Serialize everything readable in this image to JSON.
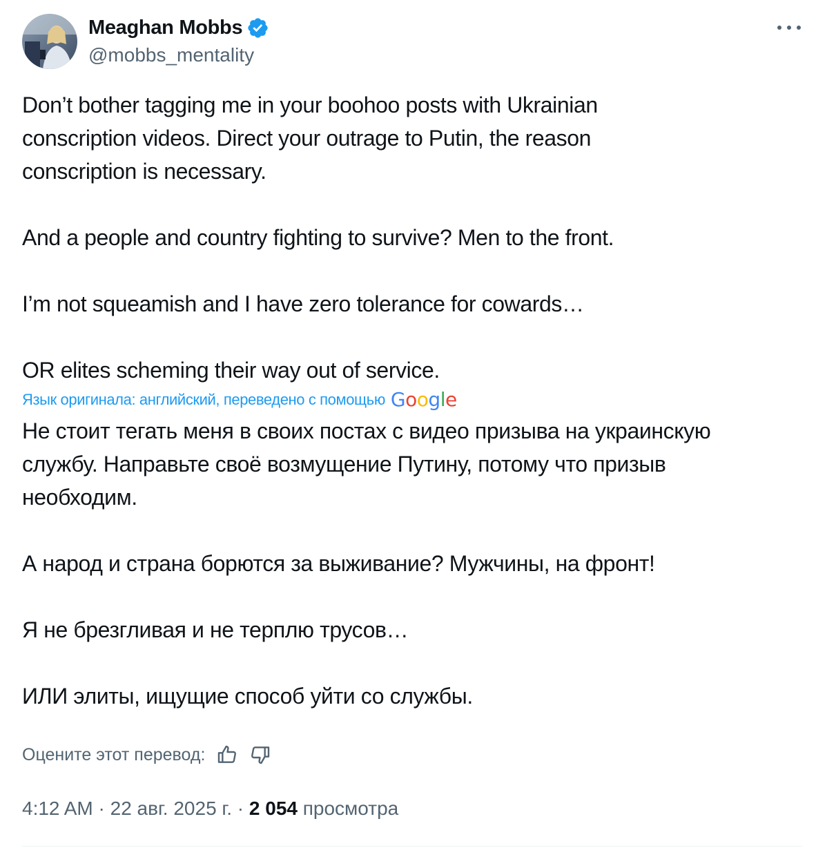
{
  "author": {
    "name": "Meaghan Mobbs",
    "handle": "@mobbs_mentality"
  },
  "icons": {
    "verified": "verified-badge-icon",
    "more": "more-options-icon",
    "thumbs_up": "thumbs-up-icon",
    "thumbs_down": "thumbs-down-icon",
    "google": "google-logo"
  },
  "original": {
    "paragraphs": [
      [
        "Don’t bother tagging me in your boohoo posts with Ukrainian",
        "conscription videos. Direct your outrage to Putin, the reason",
        "conscription is necessary."
      ],
      [
        "And a people and country fighting to survive? Men to the front."
      ],
      [
        "I’m not squeamish and I have zero tolerance for cowards…"
      ],
      [
        "OR elites scheming their way out of service."
      ]
    ]
  },
  "translation_note": "Язык оригинала: английский, переведено с помощью",
  "google_logo_text": "Google",
  "translation": {
    "paragraphs": [
      [
        "Не стоит тегать меня в своих постах с видео призыва на украинскую",
        "службу. Направьте своё возмущение Путину, потому что призыв",
        "необходим."
      ],
      [
        "А народ и страна борются за выживание? Мужчины, на фронт!"
      ],
      [
        "Я не брезгливая и не терплю трусов…"
      ],
      [
        "ИЛИ элиты, ищущие способ уйти со службы."
      ]
    ]
  },
  "rate_translation_label": "Оцените этот перевод:",
  "meta": {
    "time": "4:12 AM",
    "date": "22 авг. 2025 г.",
    "views_count": "2 054",
    "views_label": "просмотра",
    "separator": "·"
  },
  "colors": {
    "link_blue": "#1d9bf0",
    "secondary_text": "#536471",
    "primary_text": "#0f1419",
    "verified_blue": "#1d9bf0"
  }
}
